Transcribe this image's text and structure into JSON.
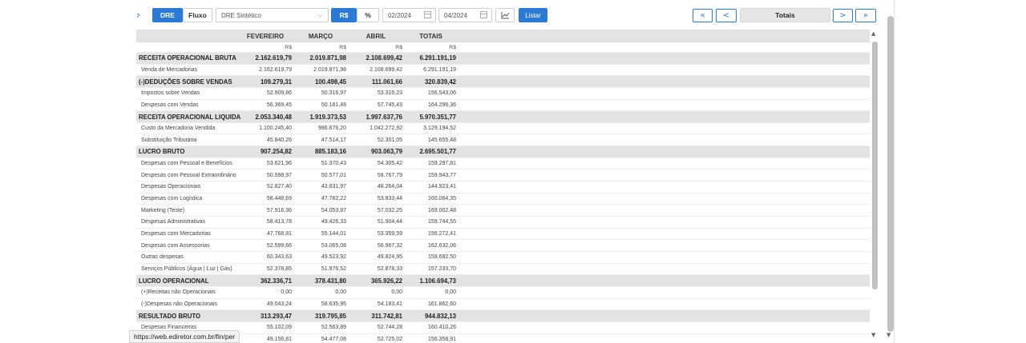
{
  "toolbar": {
    "expand_icon": "chevron-right",
    "tab_dre": "DRE",
    "tab_fluxo": "Fluxo",
    "report_select": "DRE Sintético",
    "currency_toggle": "R$",
    "percent_toggle": "%",
    "date_from": "02/2024",
    "date_to": "04/2024",
    "chart_icon": "line-chart-icon",
    "listar": "Listar",
    "pager_first": "«",
    "pager_prev": "<",
    "totais": "Totais",
    "pager_next": ">",
    "pager_last": "»",
    "accent_color": "#2b7bd6"
  },
  "table": {
    "columns": [
      "FEVEREIRO",
      "MARÇO",
      "ABRIL",
      "TOTAIS"
    ],
    "currency": [
      "R$",
      "R$",
      "R$",
      "R$"
    ],
    "rows": [
      {
        "label": "RECEITA OPERACIONAL BRUTA",
        "type": "section",
        "values": [
          "2.162.619,79",
          "2.019.871,98",
          "2.108.699,42",
          "6.291.191,19"
        ]
      },
      {
        "label": "Venda de Mercadorias",
        "type": "item",
        "values": [
          "2.162.619,79",
          "2.019.871,98",
          "2.108.699,42",
          "6.291.191,19"
        ]
      },
      {
        "label": "(-)DEDUÇÕES SOBRE VENDAS",
        "type": "section",
        "values": [
          "109.279,31",
          "100.498,45",
          "111.061,66",
          "320.839,42"
        ]
      },
      {
        "label": "Impostos sobre Vendas",
        "type": "item",
        "values": [
          "52.909,86",
          "50.316,97",
          "53.316,23",
          "156.543,06"
        ]
      },
      {
        "label": "Despesas com Vendas",
        "type": "item",
        "values": [
          "56.369,45",
          "50.181,48",
          "57.745,43",
          "164.296,36"
        ]
      },
      {
        "label": "RECEITA OPERACIONAL LIQUIDA",
        "type": "section",
        "values": [
          "2.053.340,48",
          "1.919.373,53",
          "1.997.637,76",
          "5.970.351,77"
        ]
      },
      {
        "label": "Custo da Mercadoria Vendida",
        "type": "item",
        "values": [
          "1.100.245,40",
          "986.676,20",
          "1.042.272,92",
          "3.129.194,52"
        ]
      },
      {
        "label": "Substituição Tributária",
        "type": "item",
        "values": [
          "45.840,26",
          "47.514,17",
          "52.301,05",
          "145.655,48"
        ]
      },
      {
        "label": "LUCRO BRUTO",
        "type": "section",
        "values": [
          "907.254,82",
          "885.183,16",
          "903.063,79",
          "2.695.501,77"
        ]
      },
      {
        "label": "Despesas com Pessoal e Benefícios",
        "type": "item",
        "values": [
          "53.621,96",
          "51.370,43",
          "54.305,42",
          "159.297,81"
        ]
      },
      {
        "label": "Despesas com Pessoal Extraordinário",
        "type": "item",
        "values": [
          "50.598,97",
          "50.577,01",
          "58.767,79",
          "159.943,77"
        ]
      },
      {
        "label": "Despesas Operacionais",
        "type": "item",
        "values": [
          "52.827,40",
          "43.831,97",
          "48.264,04",
          "144.923,41"
        ]
      },
      {
        "label": "Despesas com Logística",
        "type": "item",
        "values": [
          "58.448,69",
          "47.782,22",
          "53.833,44",
          "160.064,35"
        ]
      },
      {
        "label": "Marketing (Teste)",
        "type": "item",
        "values": [
          "57.916,36",
          "54.053,87",
          "57.032,25",
          "169.002,48"
        ]
      },
      {
        "label": "Despesas Administrativas",
        "type": "item",
        "values": [
          "58.413,78",
          "49.426,33",
          "51.904,44",
          "159.744,55"
        ]
      },
      {
        "label": "Despesas com Mercadorias",
        "type": "item",
        "values": [
          "47.768,81",
          "55.144,01",
          "53.359,59",
          "156.272,41"
        ]
      },
      {
        "label": "Despesas com Assessorias",
        "type": "item",
        "values": [
          "52.599,66",
          "53.065,08",
          "56.967,32",
          "162.632,06"
        ]
      },
      {
        "label": "Outras despesas",
        "type": "item",
        "values": [
          "60.343,63",
          "49.523,92",
          "49.824,95",
          "159.692,50"
        ]
      },
      {
        "label": "Serviços Públicos (Água | Luz | Gás)",
        "type": "item",
        "values": [
          "52.378,85",
          "51.976,52",
          "52.878,33",
          "157.233,70"
        ]
      },
      {
        "label": "LUCRO OPERACIONAL",
        "type": "section",
        "values": [
          "362.336,71",
          "378.431,80",
          "365.926,22",
          "1.106.694,73"
        ]
      },
      {
        "label": "(+)Receitas não Operacionais",
        "type": "item",
        "values": [
          "0,00",
          "0,00",
          "0,00",
          "0,00"
        ]
      },
      {
        "label": "(-)Despesas não Operacionais",
        "type": "item",
        "values": [
          "49.043,24",
          "58.635,95",
          "54.183,41",
          "161.862,60"
        ]
      },
      {
        "label": "RESULTADO BRUTO",
        "type": "section",
        "values": [
          "313.293,47",
          "319.795,85",
          "311.742,81",
          "944.832,13"
        ]
      },
      {
        "label": "Despesas Financeiras",
        "type": "item",
        "values": [
          "55.102,09",
          "52.563,89",
          "52.744,28",
          "160.410,26"
        ]
      },
      {
        "label": "",
        "type": "item",
        "values": [
          "49.156,81",
          "54.477,08",
          "52.725,02",
          "156.358,91"
        ]
      }
    ]
  },
  "status_bar": {
    "url": "https://web.ediretor.com.br/fin/per"
  }
}
